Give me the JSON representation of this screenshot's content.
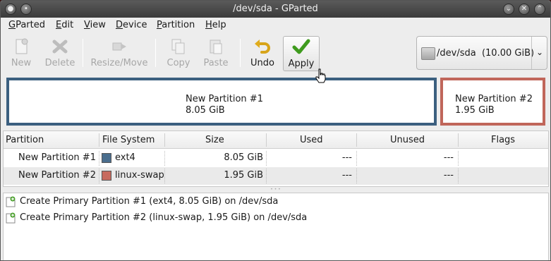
{
  "window": {
    "title": "/dev/sda - GParted"
  },
  "menu": [
    {
      "pre": "",
      "u": "G",
      "post": "Parted"
    },
    {
      "pre": "",
      "u": "E",
      "post": "dit"
    },
    {
      "pre": "",
      "u": "V",
      "post": "iew"
    },
    {
      "pre": "",
      "u": "D",
      "post": "evice"
    },
    {
      "pre": "",
      "u": "P",
      "post": "artition"
    },
    {
      "pre": "",
      "u": "H",
      "post": "elp"
    }
  ],
  "toolbar": {
    "new": "New",
    "delete": "Delete",
    "resize": "Resize/Move",
    "copy": "Copy",
    "paste": "Paste",
    "undo": "Undo",
    "apply": "Apply"
  },
  "device_selector": {
    "label": "/dev/sda  (10.00 GiB)"
  },
  "map": {
    "p1": {
      "name": "New Partition #1",
      "size": "8.05 GiB",
      "color": "#3b5f7f"
    },
    "p2": {
      "name": "New Partition #2",
      "size": "1.95 GiB",
      "color": "#c0665a"
    }
  },
  "table": {
    "headers": [
      "Partition",
      "File System",
      "Size",
      "Used",
      "Unused",
      "Flags"
    ],
    "rows": [
      {
        "partition": "New Partition #1",
        "fs": "ext4",
        "fs_color": "#4a6e8e",
        "size": "8.05 GiB",
        "used": "---",
        "unused": "---",
        "flags": ""
      },
      {
        "partition": "New Partition #2",
        "fs": "linux-swap",
        "fs_color": "#c76a5e",
        "size": "1.95 GiB",
        "used": "---",
        "unused": "---",
        "flags": ""
      }
    ]
  },
  "operations": [
    {
      "text": "Create Primary Partition #1 (ext4, 8.05 GiB) on /dev/sda",
      "icon": "new-partition-icon"
    },
    {
      "text": "Create Primary Partition #2 (linux-swap, 1.95 GiB) on /dev/sda",
      "icon": "new-partition-icon"
    }
  ]
}
